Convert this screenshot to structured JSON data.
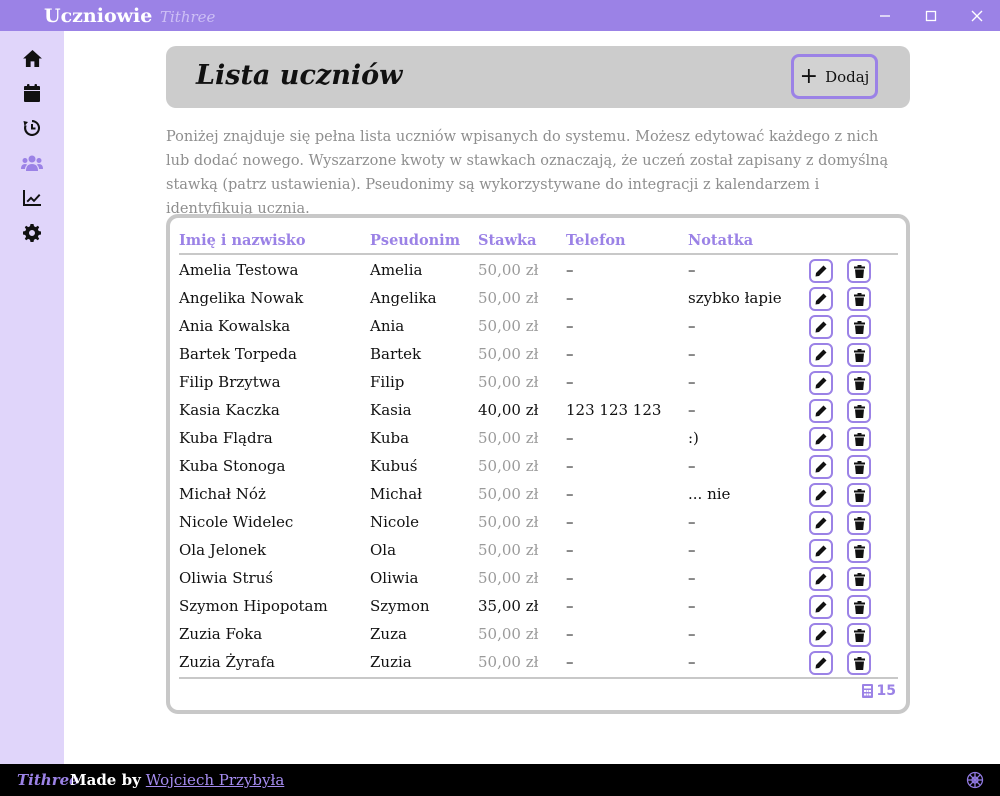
{
  "window": {
    "title": "Uczniowie",
    "brand": "Tithree"
  },
  "colors": {
    "accent": "#9b82e6",
    "sidebar_bg": "#e0d5fa",
    "header_bg": "#cccccc",
    "muted": "#8e8e8e"
  },
  "sidebar": {
    "items": [
      {
        "icon": "home-icon",
        "active": false
      },
      {
        "icon": "calendar-icon",
        "active": false
      },
      {
        "icon": "history-icon",
        "active": false
      },
      {
        "icon": "users-icon",
        "active": true
      },
      {
        "icon": "chart-line-icon",
        "active": false
      },
      {
        "icon": "gear-icon",
        "active": false
      }
    ]
  },
  "header": {
    "title": "Lista uczniów",
    "add_label": "Dodaj",
    "add_icon": "plus-icon"
  },
  "description": "Poniżej znajduje się pełna lista uczniów wpisanych do systemu. Możesz edytować każdego z nich lub dodać nowego. Wyszarzone kwoty w stawkach oznaczają, że uczeń został zapisany z domyślną stawką (patrz ustawienia). Pseudonimy są wykorzystywane do integracji z kalendarzem i identyfikują ucznia.",
  "table": {
    "columns": {
      "name": "Imię i nazwisko",
      "nick": "Pseudonim",
      "rate": "Stawka",
      "phone": "Telefon",
      "note": "Notatka"
    },
    "rows": [
      {
        "name": "Amelia Testowa",
        "nick": "Amelia",
        "rate": "50,00 zł",
        "default_rate": true,
        "phone": "–",
        "note": "–"
      },
      {
        "name": "Angelika Nowak",
        "nick": "Angelika",
        "rate": "50,00 zł",
        "default_rate": true,
        "phone": "–",
        "note": "szybko łapie"
      },
      {
        "name": "Ania Kowalska",
        "nick": "Ania",
        "rate": "50,00 zł",
        "default_rate": true,
        "phone": "–",
        "note": "–"
      },
      {
        "name": "Bartek Torpeda",
        "nick": "Bartek",
        "rate": "50,00 zł",
        "default_rate": true,
        "phone": "–",
        "note": "–"
      },
      {
        "name": "Filip Brzytwa",
        "nick": "Filip",
        "rate": "50,00 zł",
        "default_rate": true,
        "phone": "–",
        "note": "–"
      },
      {
        "name": "Kasia Kaczka",
        "nick": "Kasia",
        "rate": "40,00 zł",
        "default_rate": false,
        "phone": "123 123 123",
        "note": "–"
      },
      {
        "name": "Kuba Flądra",
        "nick": "Kuba",
        "rate": "50,00 zł",
        "default_rate": true,
        "phone": "–",
        "note": ":)"
      },
      {
        "name": "Kuba Stonoga",
        "nick": "Kubuś",
        "rate": "50,00 zł",
        "default_rate": true,
        "phone": "–",
        "note": "–"
      },
      {
        "name": "Michał Nóż",
        "nick": "Michał",
        "rate": "50,00 zł",
        "default_rate": true,
        "phone": "–",
        "note": "... nie"
      },
      {
        "name": "Nicole Widelec",
        "nick": "Nicole",
        "rate": "50,00 zł",
        "default_rate": true,
        "phone": "–",
        "note": "–"
      },
      {
        "name": "Ola Jelonek",
        "nick": "Ola",
        "rate": "50,00 zł",
        "default_rate": true,
        "phone": "–",
        "note": "–"
      },
      {
        "name": "Oliwia Struś",
        "nick": "Oliwia",
        "rate": "50,00 zł",
        "default_rate": true,
        "phone": "–",
        "note": "–"
      },
      {
        "name": "Szymon Hipopotam",
        "nick": "Szymon",
        "rate": "35,00 zł",
        "default_rate": false,
        "phone": "–",
        "note": "–"
      },
      {
        "name": "Zuzia Foka",
        "nick": "Zuza",
        "rate": "50,00 zł",
        "default_rate": true,
        "phone": "–",
        "note": "–"
      },
      {
        "name": "Zuzia Żyrafa",
        "nick": "Zuzia",
        "rate": "50,00 zł",
        "default_rate": true,
        "phone": "–",
        "note": "–"
      }
    ],
    "count": "15"
  },
  "footer": {
    "brand": "Tithree",
    "made_by": "Made by",
    "author": "Wojciech Przybyła"
  }
}
